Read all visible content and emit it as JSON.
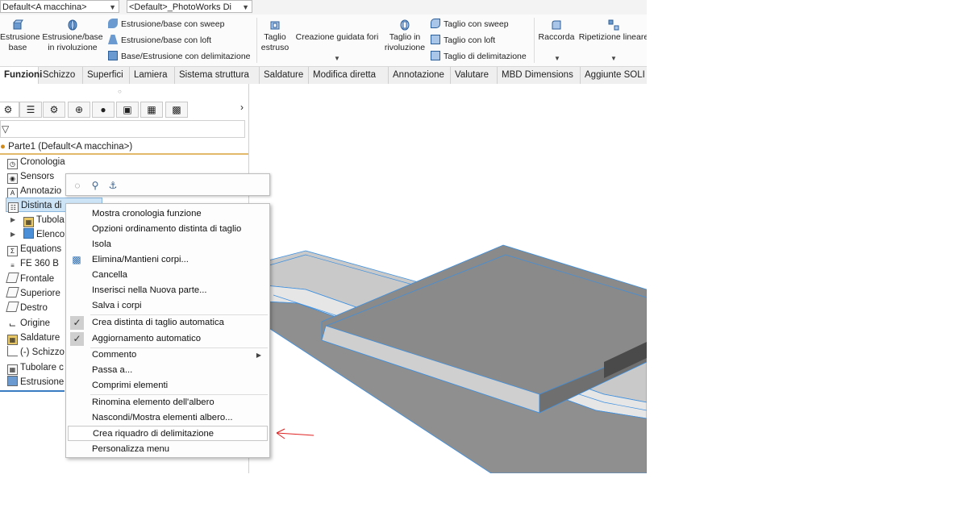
{
  "top": {
    "config_combo": "Default<A macchina>",
    "display_combo": "<Default>_PhotoWorks Di"
  },
  "ribbon": {
    "estrusione_base": "Estrusione\nbase",
    "estrusione_rivoluzione": "Estrusione/base\nin rivoluzione",
    "estrusione_sweep": "Estrusione/base con sweep",
    "estrusione_loft": "Estrusione/base con loft",
    "base_delimitazione": "Base/Estrusione con delimitazione",
    "taglio_estruso": "Taglio\nestruso",
    "creazione_guidata_fori": "Creazione guidata fori",
    "taglio_rivoluzione": "Taglio in\nrivoluzione",
    "taglio_sweep": "Taglio con sweep",
    "taglio_loft": "Taglio con loft",
    "taglio_delimitazione": "Taglio di delimitazione",
    "raccorda": "Raccorda",
    "ripetizione_lineare": "Ripetizione lineare"
  },
  "tabs": [
    "Funzioni",
    "Schizzo",
    "Superfici",
    "Lamiera",
    "Sistema struttura",
    "Saldature",
    "Modifica diretta",
    "Annotazione",
    "Valutare",
    "MBD Dimensions",
    "Aggiunte SOLI"
  ],
  "tree": {
    "root": "Parte1  (Default<A macchina>)",
    "items": [
      {
        "label": "Cronologia",
        "icon": "history-icon"
      },
      {
        "label": "Sensors",
        "icon": "sensor-icon"
      },
      {
        "label": "Annotazio",
        "icon": "annotation-icon"
      },
      {
        "label": "Distinta di",
        "icon": "cutlist-icon"
      },
      {
        "label": "Tubola",
        "icon": "tube-icon"
      },
      {
        "label": "Elenco",
        "icon": "folder-icon"
      },
      {
        "label": "Equations",
        "icon": "equations-icon"
      },
      {
        "label": "FE 360 B",
        "icon": "material-icon"
      },
      {
        "label": "Frontale",
        "icon": "plane-icon"
      },
      {
        "label": "Superiore",
        "icon": "plane-icon"
      },
      {
        "label": "Destro",
        "icon": "plane-icon"
      },
      {
        "label": "Origine",
        "icon": "origin-icon"
      },
      {
        "label": "Saldature",
        "icon": "weldment-icon"
      },
      {
        "label": "(-) Schizzo",
        "icon": "sketch-icon"
      },
      {
        "label": "Tubolare c",
        "icon": "tube-icon"
      },
      {
        "label": "Estrusione",
        "icon": "extrude-icon"
      }
    ]
  },
  "context_menu": {
    "items": [
      "Mostra cronologia funzione",
      "Opzioni ordinamento distinta di taglio",
      "Isola",
      "Elimina/Mantieni corpi...",
      "Cancella",
      "Inserisci nella Nuova parte...",
      "Salva i corpi",
      "Crea distinta di taglio automatica",
      "Aggiornamento automatico",
      "Commento",
      "Passa a...",
      "Comprimi elementi",
      "Rinomina elemento dell'albero",
      "Nascondi/Mostra elementi albero...",
      "Crea riquadro di delimitazione",
      "Personalizza menu"
    ],
    "checked": [
      "Crea distinta di taglio automatica",
      "Aggiornamento automatico"
    ]
  },
  "colors": {
    "accent": "#3a7cc2",
    "selection": "#cde4f7",
    "annotation_arrow": "#e02020",
    "model_gray": "#8a8a8a"
  }
}
